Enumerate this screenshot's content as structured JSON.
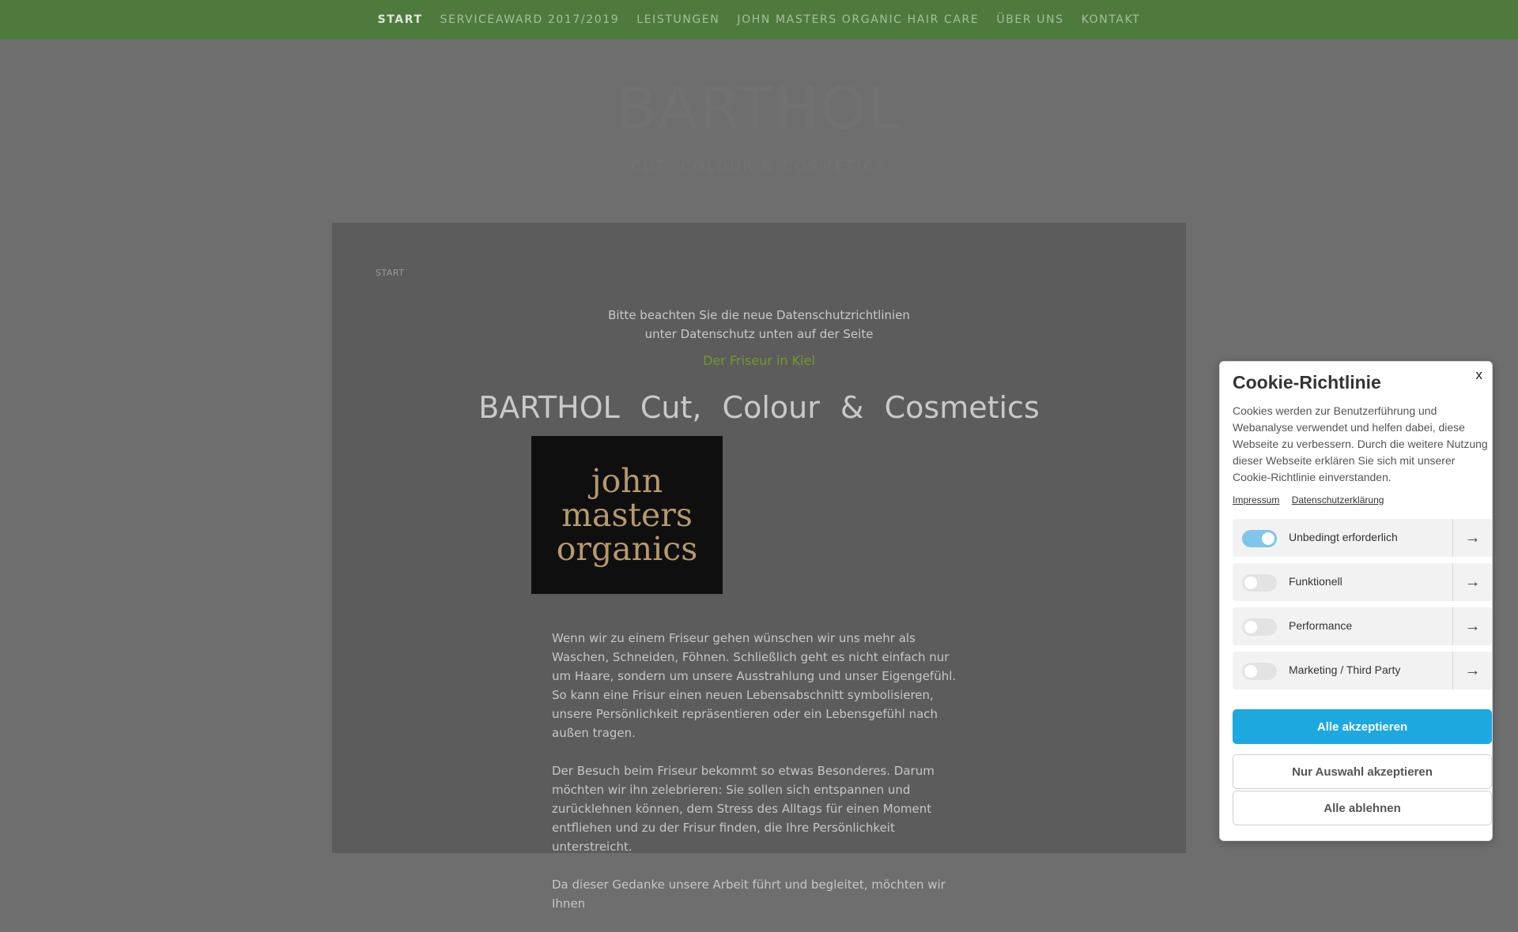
{
  "nav": {
    "items": [
      {
        "label": "START"
      },
      {
        "label": "SERVICEAWARD 2017/2019"
      },
      {
        "label": "LEISTUNGEN"
      },
      {
        "label": "JOHN MASTERS ORGANIC HAIR CARE"
      },
      {
        "label": "ÜBER UNS"
      },
      {
        "label": "KONTAKT"
      }
    ]
  },
  "header": {
    "title": "BARTHOL",
    "subtitle": "CUT, COLOUR & COSMETICS"
  },
  "main": {
    "breadcrumb": "START",
    "notice_line1": "Bitte beachten Sie die neue Datenschutzrichtlinien",
    "notice_line2": "unter Datenschutz unten auf der Seite",
    "tagline": "Der Friseur in Kiel",
    "headline": "BARTHOL Cut, Colour & Cosmetics",
    "logo": {
      "line1": "john",
      "line2": "masters",
      "line3": "organics"
    },
    "paragraphs": [
      "Wenn wir zu einem Friseur gehen wünschen wir uns mehr als Waschen, Schneiden, Föhnen. Schließlich geht es nicht einfach nur um Haare, sondern um unsere Ausstrahlung und unser Eigengefühl. So kann eine Frisur einen neuen Lebensabschnitt symbolisieren, unsere Persönlichkeit repräsentieren oder ein Lebensgefühl nach außen tragen.",
      "Der Besuch beim Friseur bekommt so etwas Besonderes. Darum möchten wir ihn zelebrieren: Sie sollen sich entspannen und zurücklehnen können, dem Stress des Alltags für einen Moment entfliehen und zu der Frisur finden, die Ihre Persönlichkeit unterstreicht.",
      "Da dieser Gedanke unsere Arbeit führt und begleitet, möchten wir Ihnen"
    ]
  },
  "cookie": {
    "close": "x",
    "title": "Cookie-Richtlinie",
    "description": "Cookies werden zur Benutzerführung und Webanalyse verwendet und helfen dabei, diese Webseite zu verbessern. Durch die weitere Nutzung dieser Webseite erklären Sie sich mit unserer Cookie-Richtlinie einverstanden.",
    "link_impressum": "Impressum",
    "link_privacy": "Datenschutzerklärung",
    "categories": [
      {
        "label": "Unbedingt erforderlich",
        "enabled": true
      },
      {
        "label": "Funktionell",
        "enabled": false
      },
      {
        "label": "Performance",
        "enabled": false
      },
      {
        "label": "Marketing / Third Party",
        "enabled": false
      }
    ],
    "accept_all": "Alle akzeptieren",
    "accept_selection": "Nur Auswahl akzeptieren",
    "reject_all": "Alle ablehnen"
  },
  "colors": {
    "nav_bg": "#4f7a3e",
    "accent_green": "#6c9b2b",
    "primary_button": "#1ea8e0",
    "toggle_on": "#7fc5ec"
  },
  "icons": {
    "category_arrow": "arrow-right-icon",
    "close": "close-icon"
  }
}
